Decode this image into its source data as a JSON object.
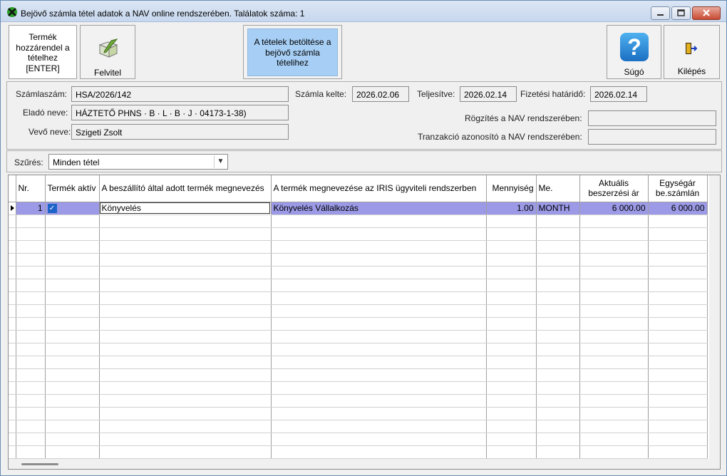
{
  "window": {
    "title": "Bejövő számla tétel adatok a NAV online rendszerében. Találatok száma: 1",
    "controls": [
      "minimize",
      "maximize",
      "close"
    ]
  },
  "toolbar": {
    "assign_label_1": "Termék",
    "assign_label_2": "hozzárendel a",
    "assign_label_3": "tételhez",
    "assign_label_4": "[ENTER]",
    "record_label": "Felvitel",
    "load_label_1": "A tételek betöltése a",
    "load_label_2": "bejövő számla",
    "load_label_3": "tételihez",
    "help_label": "Súgó",
    "exit_label": "Kilépés"
  },
  "invoice": {
    "number_label": "Számlaszám:",
    "number_value": "HSA/2026/142",
    "seller_label": "Eladó neve:",
    "seller_value": "HÁZTETŐ PHNS · B · L · B · J · 04173-1-38)",
    "buyer_label": "Vevő neve:",
    "buyer_value": "Szigeti Zsolt",
    "issue_label": "Számla kelte:",
    "issue_value": "2026.02.06",
    "fulfil_label": "Teljesítve:",
    "fulfil_value": "2026.02.14",
    "due_label": "Fizetési határidő:",
    "due_value": "2026.02.14",
    "nav_record_label": "Rögzítés a NAV rendszerében:",
    "nav_record_value": "",
    "nav_tx_label": "Tranzakció azonosító a NAV rendszerében:",
    "nav_tx_value": ""
  },
  "filter": {
    "label": "Szűrés:",
    "value": "Minden tétel"
  },
  "grid": {
    "headers": {
      "nr": "Nr.",
      "active": "Termék aktív",
      "supplier_name": "A beszállító által adott termék megnevezés",
      "iris_name": "A termék megnevezése az IRIS ügyviteli rendszerben",
      "qty": "Mennyiség",
      "unit": "Me.",
      "price_1": "Aktuális",
      "price_2": "beszerzési ár",
      "unitprice_1": "Egységár",
      "unitprice_2": "be.számlán"
    },
    "rows": [
      {
        "nr": "1",
        "active": true,
        "supplier_name": "Könyvelés",
        "iris_name": "Könyvelés Vállalkozás",
        "qty": "1.00",
        "unit": "MONTH",
        "price": "6 000.00",
        "unitprice": "6 000.00"
      }
    ]
  },
  "colors": {
    "selected_row": "#9c9ae6",
    "load_button": "#a7cff5",
    "checkbox": "#1e63c8"
  }
}
